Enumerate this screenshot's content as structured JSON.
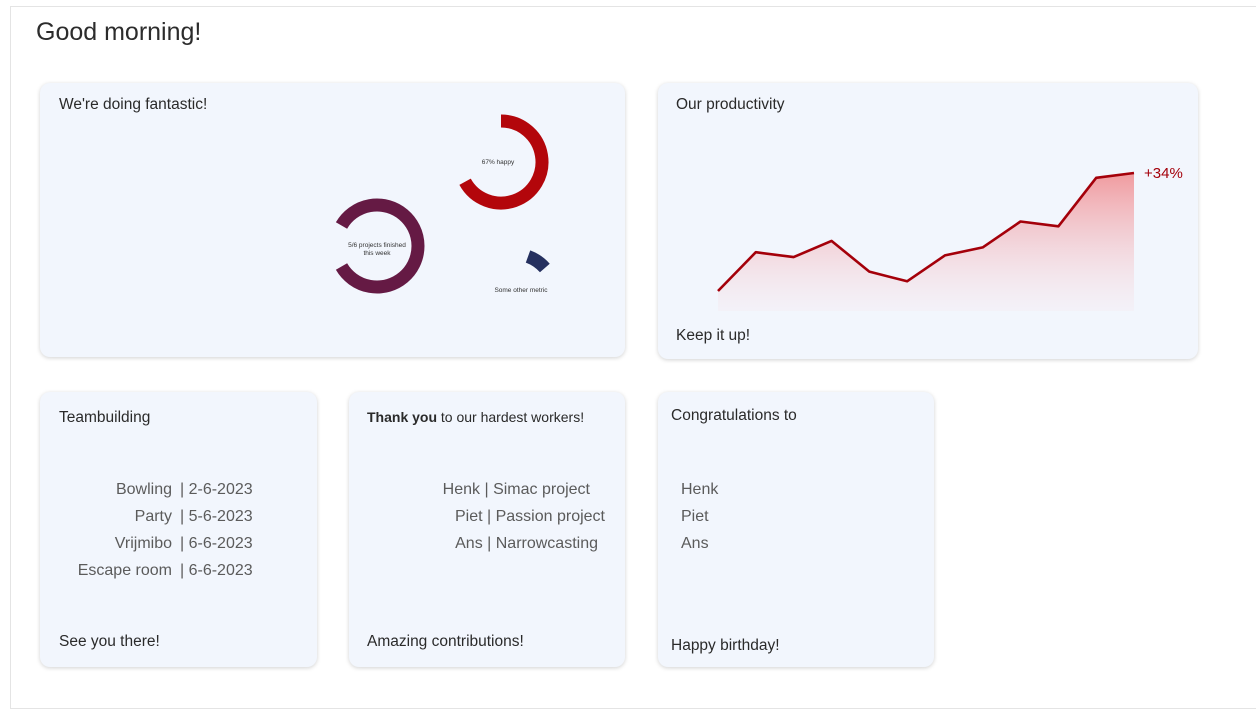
{
  "greeting": "Good morning!",
  "cards": {
    "fantastic": {
      "title": "We're doing fantastic!",
      "metrics": [
        {
          "label": "67% happy",
          "value": 0.67,
          "color": "#b3060b"
        },
        {
          "label_line1": "5/6 projects finished",
          "label_line2": "this week",
          "value": 0.8333,
          "color": "#651a44"
        },
        {
          "label": "Some other metric",
          "value": 0.08,
          "color": "#25305f"
        }
      ]
    },
    "productivity": {
      "title": "Our productivity",
      "footer": "Keep it up!",
      "change_label": "+34%",
      "line_color": "#a4000a",
      "chart_data": {
        "type": "area",
        "values": [
          0,
          2.4,
          2.1,
          3.1,
          1.2,
          0.6,
          2.2,
          2.7,
          4.3,
          4.0,
          7.0,
          7.3
        ]
      }
    },
    "teambuilding": {
      "title": "Teambuilding",
      "footer": "See you there!",
      "events": [
        {
          "name": "Bowling",
          "date": "| 2-6-2023"
        },
        {
          "name": "Party",
          "date": "| 5-6-2023"
        },
        {
          "name": "Vrijmibo",
          "date": "| 6-6-2023"
        },
        {
          "name": "Escape room",
          "date": "| 6-6-2023"
        }
      ]
    },
    "thanks": {
      "title_bold": "Thank you",
      "title_rest": " to our hardest workers!",
      "footer": "Amazing contributions!",
      "workers": [
        "Henk | Simac project",
        "Piet | Passion project",
        "Ans | Narrowcasting"
      ]
    },
    "congrats": {
      "title": "Congratulations to",
      "footer": "Happy birthday!",
      "names": [
        "Henk",
        "Piet",
        "Ans"
      ]
    }
  }
}
